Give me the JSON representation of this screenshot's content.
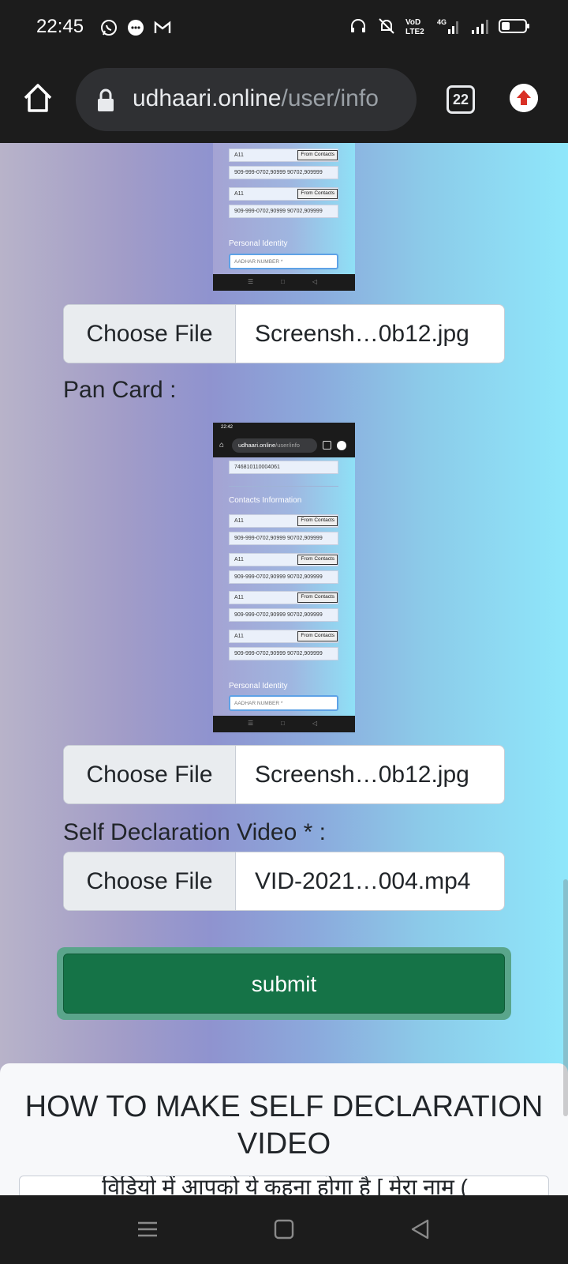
{
  "status_bar": {
    "time": "22:45",
    "left_icons": [
      "whatsapp-icon",
      "message-icon",
      "gmail-icon"
    ],
    "right_icons": [
      "headset-icon",
      "mute-icon",
      "volte-icon",
      "4g-signal-icon",
      "signal-icon",
      "battery-icon"
    ],
    "network_label": "Vo) LTE2",
    "data_label": "4G"
  },
  "browser": {
    "url_host": "udhaari.online",
    "url_path": "/user/info",
    "tab_count": "22",
    "load_progress": 0.05
  },
  "page": {
    "aadhar_preview": {
      "contacts": [
        {
          "name": "A11",
          "numbers": "909-999-0702,90999 90702,909999"
        },
        {
          "name": "A11",
          "numbers": "909-999-0702,90999 90702,909999"
        }
      ],
      "from_contacts_label": "From Contacts",
      "personal_identity": "Personal Identity",
      "aadhar_placeholder": "AADHAR NUMBER *"
    },
    "aadhar_file": {
      "button_label": "Choose File",
      "filename": "Screensh…0b12.jpg"
    },
    "pan_label": "Pan Card :",
    "pan_preview": {
      "mini_time": "22:42",
      "mini_url_host": "udhaari.online",
      "mini_url_path": "/user/info",
      "top_value": "746810110004061",
      "section_title": "Contacts Information",
      "contacts": [
        {
          "name": "A11",
          "numbers": "909-999-0702,90999 90702,909999"
        },
        {
          "name": "A11",
          "numbers": "909-999-0702,90999 90702,909999"
        },
        {
          "name": "A11",
          "numbers": "909-999-0702,90999 90702,909999"
        },
        {
          "name": "A11",
          "numbers": "909-999-0702,90999 90702,909999"
        }
      ],
      "from_contacts_label": "From Contacts",
      "personal_identity": "Personal Identity",
      "aadhar_placeholder": "AADHAR NUMBER *"
    },
    "pan_file": {
      "button_label": "Choose File",
      "filename": "Screensh…0b12.jpg"
    },
    "video_label": "Self Declaration Video * :",
    "video_file": {
      "button_label": "Choose File",
      "filename": "VID-2021…004.mp4"
    },
    "submit_label": "submit",
    "howto_title": "HOW TO MAKE SELF DECLARATION VIDEO",
    "howto_text": "विडियो में आपको ये कहना होगा है [ मेरा नाम ("
  },
  "navbar": {
    "icons": [
      "menu-icon",
      "home-square-icon",
      "back-icon"
    ]
  },
  "colors": {
    "submit": "#157347",
    "submit_ring": "#5aa58b",
    "gradient_left": "#b8b3c9",
    "gradient_right": "#8fe7fb"
  }
}
